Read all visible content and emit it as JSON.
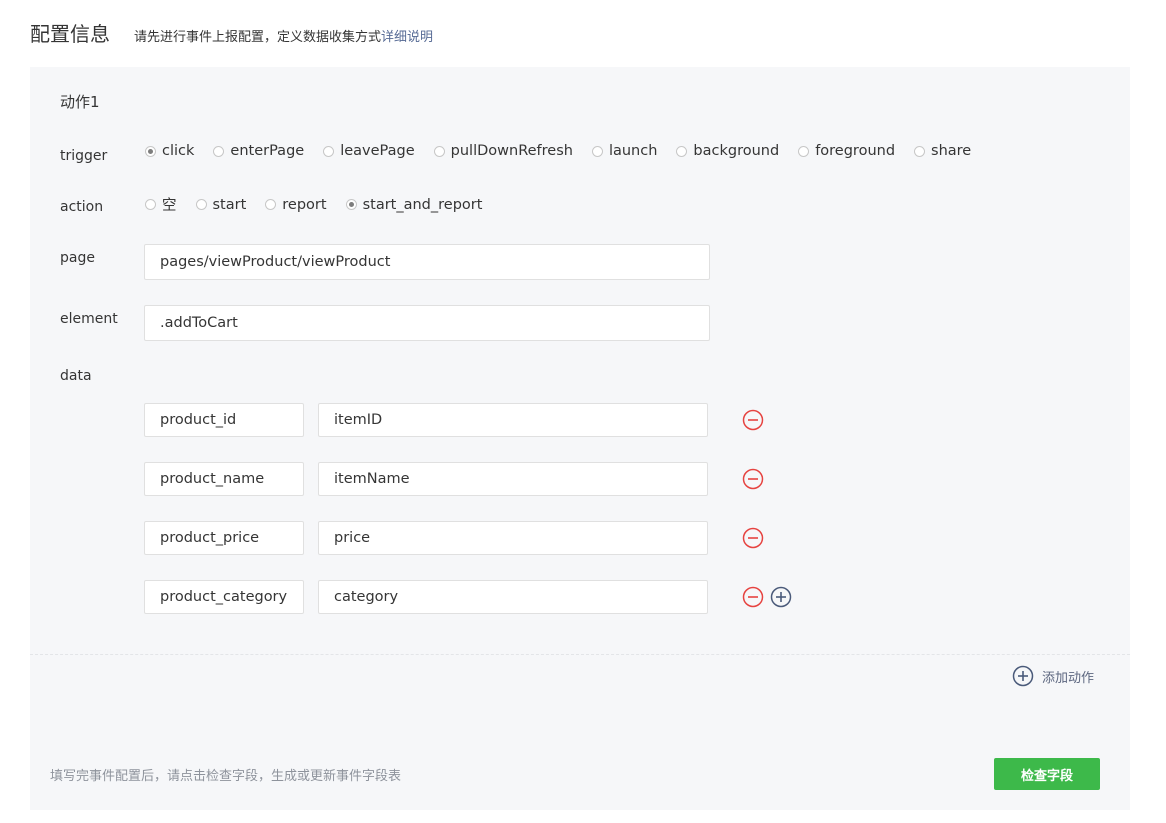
{
  "header": {
    "title": "配置信息",
    "description": "请先进行事件上报配置，定义数据收集方式",
    "help_link": "详细说明"
  },
  "action": {
    "title": "动作1",
    "trigger": {
      "label": "trigger",
      "options": [
        "click",
        "enterPage",
        "leavePage",
        "pullDownRefresh",
        "launch",
        "background",
        "foreground",
        "share"
      ],
      "selected": "click"
    },
    "action_type": {
      "label": "action",
      "options": [
        "空",
        "start",
        "report",
        "start_and_report"
      ],
      "selected": "start_and_report"
    },
    "page": {
      "label": "page",
      "value": "pages/viewProduct/viewProduct"
    },
    "element": {
      "label": "element",
      "value": ".addToCart"
    },
    "data": {
      "label": "data",
      "rows": [
        {
          "key": "product_id",
          "value": "itemID"
        },
        {
          "key": "product_name",
          "value": "itemName"
        },
        {
          "key": "product_price",
          "value": "price"
        },
        {
          "key": "product_category",
          "value": "category"
        }
      ]
    }
  },
  "add_action_label": "添加动作",
  "footer": {
    "hint": "填写完事件配置后，请点击检查字段，生成或更新事件字段表",
    "check_button": "检查字段"
  },
  "colors": {
    "remove_icon": "#e64340",
    "add_icon": "#4a5a7a",
    "primary_button": "#3db94a",
    "link": "#576b95"
  }
}
